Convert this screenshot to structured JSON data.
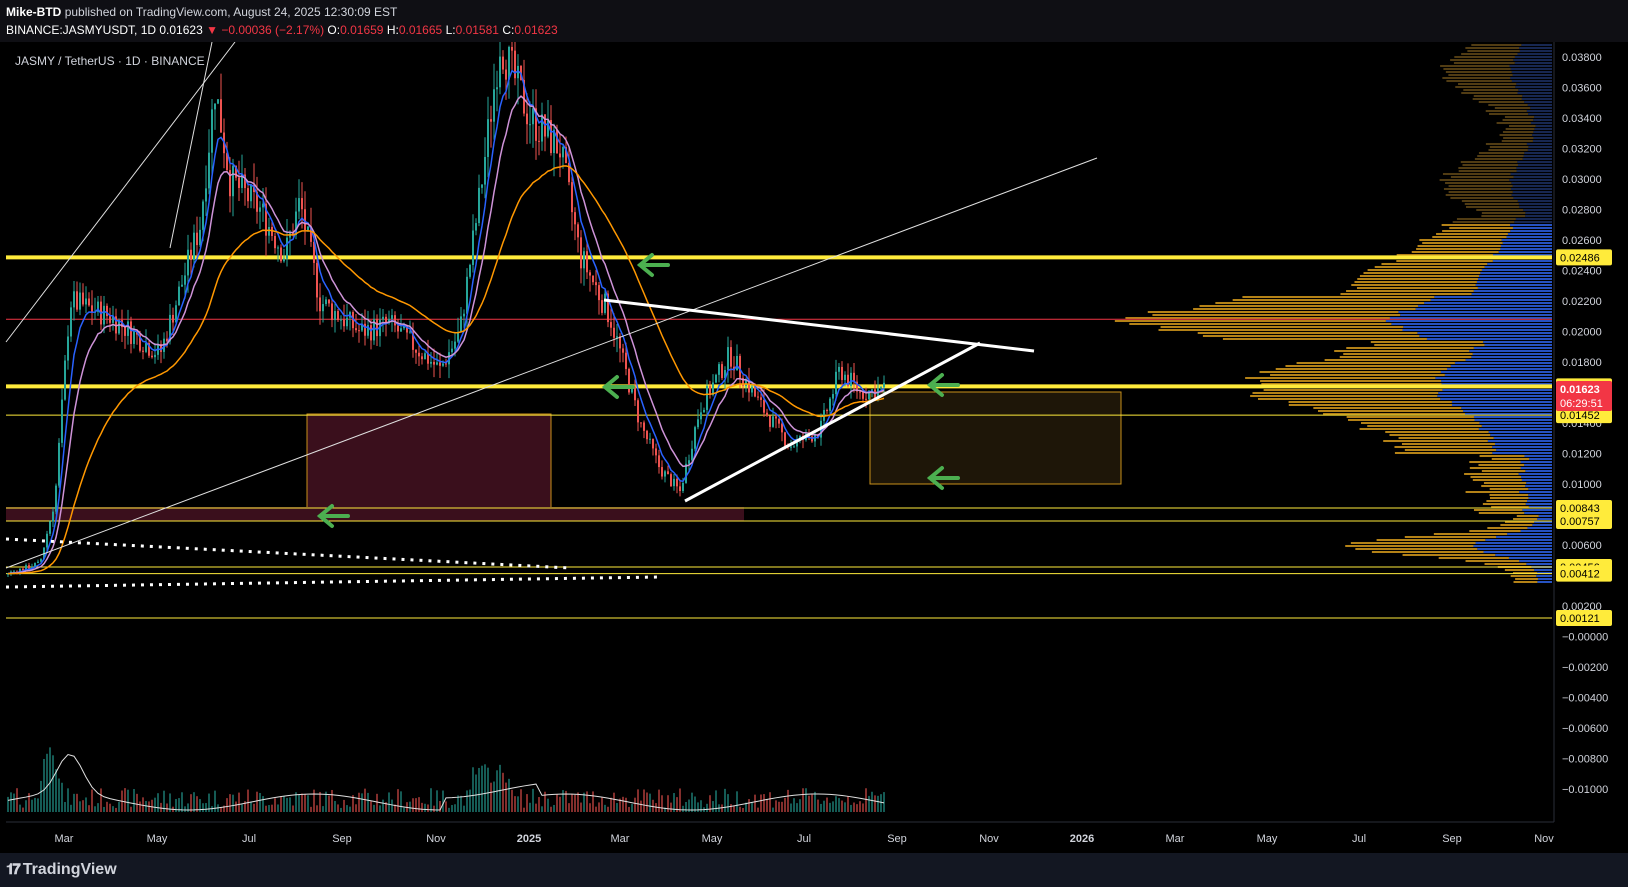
{
  "header": {
    "author": "Mike-BTD",
    "published_text": "published on TradingView.com, August 24, 2025 12:30:09 EST",
    "symbol": "BINANCE:JASMYUSDT, 1D",
    "last": "0.01623",
    "change": "▼ −0.00036 (−2.17%)",
    "o_label": "O:",
    "o_value": "0.01659",
    "h_label": "H:",
    "h_value": "0.01665",
    "l_label": "L:",
    "l_value": "0.01581",
    "c_label": "C:",
    "c_value": "0.01623"
  },
  "chart_title": "JASMY / TetherUS · 1D · BINANCE",
  "chart_data": {
    "type": "line",
    "y_axis_ticks": [
      "0.03800",
      "0.03600",
      "0.03400",
      "0.03200",
      "0.03000",
      "0.02800",
      "0.02600",
      "0.02400",
      "0.02200",
      "0.02000",
      "0.01800",
      "0.01600",
      "0.01400",
      "0.01200",
      "0.01000",
      "0.00800",
      "0.00600",
      "0.00400",
      "0.00200",
      "−0.00000",
      "−0.00200",
      "−0.00400",
      "−0.00600",
      "−0.00800",
      "−0.01000"
    ],
    "x_axis_labels": [
      "Mar",
      "May",
      "Jul",
      "Sep",
      "Nov",
      "2025",
      "Mar",
      "May",
      "Jul",
      "Sep",
      "Nov",
      "2026",
      "Mar",
      "May",
      "Jul",
      "Sep",
      "Nov"
    ],
    "price_labels": [
      {
        "text": "0.02486",
        "value": 0.02486,
        "color": "#ffeb3b"
      },
      {
        "text": "0.01640",
        "value": 0.0164,
        "color": "#ffeb3b"
      },
      {
        "text": "0.01452",
        "value": 0.01452,
        "color": "#ffeb3b"
      },
      {
        "text": "0.00843",
        "value": 0.00843,
        "color": "#ffeb3b"
      },
      {
        "text": "0.00757",
        "value": 0.00757,
        "color": "#ffeb3b"
      },
      {
        "text": "0.00456",
        "value": 0.00456,
        "color": "#ffeb3b"
      },
      {
        "text": "0.00412",
        "value": 0.00412,
        "color": "#ffeb3b"
      },
      {
        "text": "0.00121",
        "value": 0.00121,
        "color": "#ffeb3b"
      }
    ],
    "current_price": {
      "text": "0.01623",
      "countdown": "06:29:51",
      "value": 0.01623,
      "color": "#f23645"
    },
    "horizontal_levels": [
      {
        "value": 0.02486,
        "color": "#ffeb3b",
        "style": "thick"
      },
      {
        "value": 0.0208,
        "color": "#f23645",
        "style": "thin"
      },
      {
        "value": 0.0164,
        "color": "#ffeb3b",
        "style": "thick"
      },
      {
        "value": 0.01452,
        "color": "#ffeb3b",
        "style": "thin"
      },
      {
        "value": 0.00843,
        "color": "#ffeb3b",
        "style": "thin"
      },
      {
        "value": 0.00757,
        "color": "#ffeb3b",
        "style": "thin"
      },
      {
        "value": 0.00456,
        "color": "#ffeb3b",
        "style": "thin"
      },
      {
        "value": 0.00412,
        "color": "#ffeb3b",
        "style": "thin"
      },
      {
        "value": 0.00121,
        "color": "#ffeb3b",
        "style": "thin"
      }
    ],
    "colors": {
      "up": "#26a69a",
      "down": "#ef5350",
      "ema_fast": "#2962ff",
      "ema_mid": "#ce93d8",
      "ema_slow": "#ff9800",
      "level": "#ffeb3b",
      "arrow": "#4caf50",
      "volume_profile_a": "#c8901a",
      "volume_profile_b": "#2a5bd7"
    }
  },
  "footer": {
    "brand": "TradingView"
  }
}
